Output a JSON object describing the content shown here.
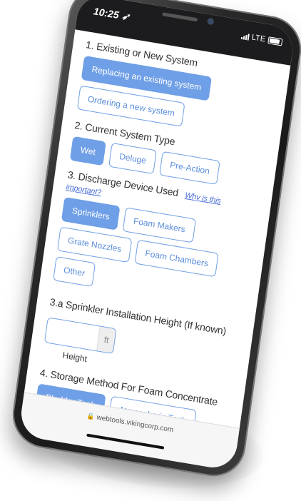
{
  "status_bar": {
    "time": "10:25",
    "location_glyph": "➶",
    "network": "LTE"
  },
  "sections": {
    "existing": {
      "title": "1. Existing or New System",
      "options": [
        {
          "label": "Replacing an existing system",
          "selected": true
        },
        {
          "label": "Ordering a new system",
          "selected": false
        }
      ]
    },
    "system_type": {
      "title": "2. Current System Type",
      "options": [
        {
          "label": "Wet",
          "selected": true
        },
        {
          "label": "Deluge",
          "selected": false
        },
        {
          "label": "Pre-Action",
          "selected": false
        }
      ]
    },
    "discharge": {
      "title": "3. Discharge Device Used",
      "help_link": "Why is this important?",
      "options": [
        {
          "label": "Sprinklers",
          "selected": true
        },
        {
          "label": "Foam Makers",
          "selected": false
        },
        {
          "label": "Grate Nozzles",
          "selected": false
        },
        {
          "label": "Foam Chambers",
          "selected": false
        },
        {
          "label": "Other",
          "selected": false
        }
      ]
    },
    "height": {
      "title": "3.a Sprinkler Installation Height (If known)",
      "value": "",
      "unit": "ft",
      "label": "Height"
    },
    "storage": {
      "title": "4. Storage Method For Foam Concentrate",
      "options": [
        {
          "label": "Bladder Tank",
          "selected": true
        },
        {
          "label": "Atmospheric Tank",
          "selected": false
        }
      ]
    }
  },
  "browser": {
    "url": "webtools.vikingcorp.com"
  },
  "colors": {
    "accent": "#6f9fe6",
    "link": "#4a6fd8"
  }
}
